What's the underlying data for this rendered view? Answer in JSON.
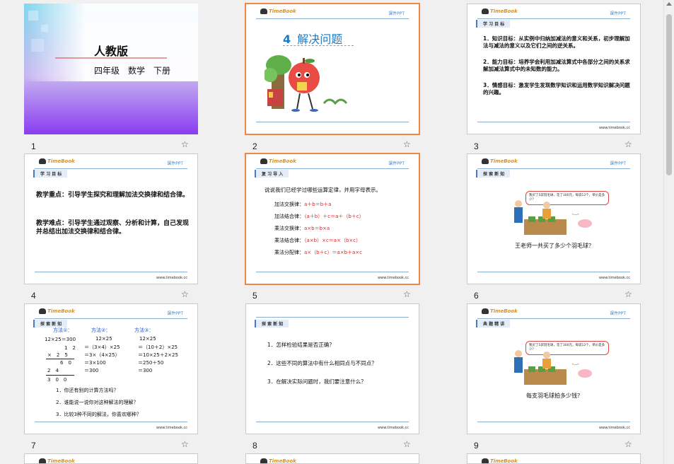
{
  "slides": [
    {
      "number": "1",
      "title": "人教版",
      "subtitle": "四年级　数学　下册"
    },
    {
      "number": "2",
      "title_num": "4",
      "title": "解决问题"
    },
    {
      "number": "3",
      "section": "学 习 目 标",
      "lines": [
        "1．知识目标：从实例中归纳加减法的意义和关系，初步理解加法与减法的意义以及它们之间的逆关系。",
        "2．能力目标：培养学会利用加减法算式中各部分之间的关系求解加减法算式中的未知数的能力。",
        "3．情感目标：激发学生发现数学知识和运用数学知识解决问题的兴趣。"
      ]
    },
    {
      "number": "4",
      "section": "学 习 目 标",
      "lines": [
        "教学重点：引导学生探究和理解加法交换律和结合律。",
        "教学难点：引导学生通过观察、分析和计算，自己发现并总结出加法交换律和结合律。"
      ]
    },
    {
      "number": "5",
      "section": "复 习 导 入",
      "intro": "说说我们已经学过哪些运算定律，并用字母表示。",
      "laws": [
        {
          "name": "加法交换律：",
          "formula": "a＋b＝b＋a"
        },
        {
          "name": "加法结合律：",
          "formula": "（a＋b）＋c＝a＋（b＋c）"
        },
        {
          "name": "乘法交换律：",
          "formula": "a×b＝b×a"
        },
        {
          "name": "乘法结合律：",
          "formula": "（a×b）×c＝a×（b×c）"
        },
        {
          "name": "乘法分配律：",
          "formula": "a×（b＋c）＝a×b＋a×c"
        }
      ]
    },
    {
      "number": "6",
      "section": "探 索 新 知",
      "bubble": "我买了5袋羽毛球，花了300元，每袋12个，单价是多少？",
      "question": "王老师一共买了多少个羽毛球？"
    },
    {
      "number": "7",
      "section": "探 索 新 知",
      "methods": [
        "方法①：",
        "方法②：",
        "方法③："
      ],
      "m1": [
        "12×25＝300",
        "1　2",
        "×　2　5",
        "6　0",
        "2　4",
        "3　0　0"
      ],
      "m2": [
        "12×25",
        "＝（3×4）×25",
        "＝3×（4×25）",
        "＝3×100",
        "＝300"
      ],
      "m3": [
        "12×25",
        "＝（10＋2）×25",
        "＝10×25＋2×25",
        "＝250＋50",
        "＝300"
      ],
      "questions": [
        "1．你还有别的计算方法吗？",
        "2．谁能说一说你对这种解法的理解？",
        "3．比较3种不同的解法，你喜欢哪种？"
      ]
    },
    {
      "number": "8",
      "section": "探 索 新 知",
      "questions": [
        "1．怎样检验结果是否正确？",
        "2．这些不同的算法中有什么相同点与不同点？",
        "3．在解决实际问题时，我们要注意什么？"
      ]
    },
    {
      "number": "9",
      "section": "典 题 精 讲",
      "bubble": "我买了5袋羽毛球，花了300元，每袋12个，单价是多少？",
      "question": "每支羽毛球拍多少钱？"
    }
  ],
  "common": {
    "logo": "TimeBook",
    "courseware": "课件PPT",
    "url": "www.timebook.cc",
    "star": "☆"
  },
  "colors": {
    "selected_border": "#f0874a",
    "accent_blue": "#4a88c4",
    "formula_red": "#d22222"
  }
}
